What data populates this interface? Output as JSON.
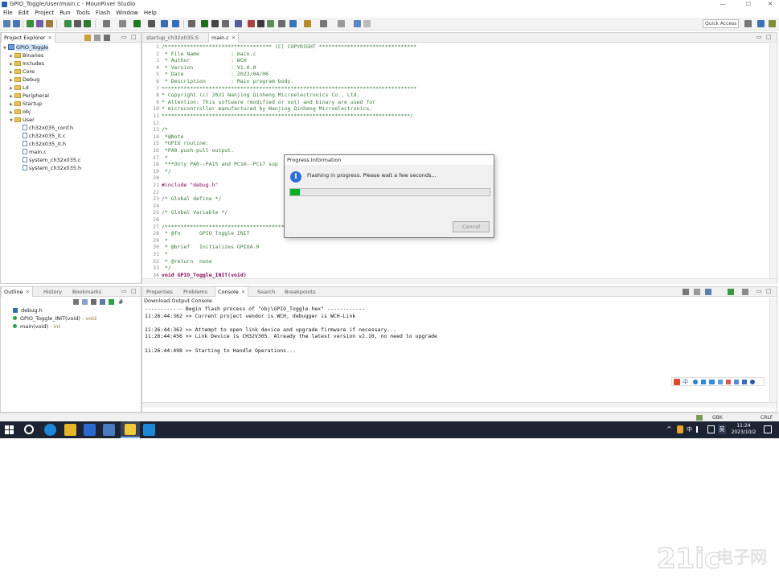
{
  "window": {
    "title": "GPIO_Toggle/User/main.c - MounRiver Studio",
    "controls": {
      "minimize": "—",
      "maximize": "☐",
      "close": "✕"
    }
  },
  "menu": [
    "File",
    "Edit",
    "Project",
    "Run",
    "Tools",
    "Flash",
    "Window",
    "Help"
  ],
  "toolbar": {
    "quick_access": "Quick Access"
  },
  "project_explorer": {
    "tab": "Project Explorer",
    "project": "GPIO_Toggle",
    "folders": [
      "Binaries",
      "Includes",
      "Core",
      "Debug",
      "Ld",
      "Peripheral",
      "Startup",
      "obj",
      "User"
    ],
    "user_files": [
      "ch32x035_conf.h",
      "ch32x035_it.c",
      "ch32x035_it.h",
      "main.c",
      "system_ch32x035.c",
      "system_ch32x035.h"
    ]
  },
  "editor": {
    "tabs": [
      "startup_ch32x035.S",
      "main.c"
    ],
    "lines": [
      {
        "n": "1",
        "t": "/********************************** (C) COPYRIGHT *******************************",
        "c": "cmt"
      },
      {
        "n": "2",
        "t": " * File Name          : main.c",
        "c": "cmt"
      },
      {
        "n": "3",
        "t": " * Author             : WCH",
        "c": "cmt"
      },
      {
        "n": "4",
        "t": " * Version            : V1.0.0",
        "c": "cmt"
      },
      {
        "n": "5",
        "t": " * Date               : 2023/04/06",
        "c": "cmt"
      },
      {
        "n": "6",
        "t": " * Description        : Main program body.",
        "c": "cmt"
      },
      {
        "n": "7",
        "t": "*********************************************************************************",
        "c": "cmt"
      },
      {
        "n": "8",
        "t": "* Copyright (c) 2021 Nanjing Qinheng Microelectronics Co., Ltd.",
        "c": "cmt"
      },
      {
        "n": "9",
        "t": "* Attention: This software (modified or not) and binary are used for",
        "c": "cmt"
      },
      {
        "n": "10",
        "t": "* microcontroller manufactured by Nanjing Qinheng Microelectronics.",
        "c": "cmt"
      },
      {
        "n": "11",
        "t": "*******************************************************************************/",
        "c": "cmt"
      },
      {
        "n": "12",
        "t": "",
        "c": ""
      },
      {
        "n": "13",
        "t": "/*",
        "c": "cmt"
      },
      {
        "n": "14",
        "t": " *@Note",
        "c": "cmt"
      },
      {
        "n": "15",
        "t": " *GPIO routine:",
        "c": "cmt"
      },
      {
        "n": "16",
        "t": " *PA0 push-pull output.",
        "c": "cmt"
      },
      {
        "n": "17",
        "t": " *",
        "c": "cmt"
      },
      {
        "n": "18",
        "t": " ***Only PA0--PA15 and PC16--PC17 sup",
        "c": "cmt"
      },
      {
        "n": "19",
        "t": " */",
        "c": "cmt"
      },
      {
        "n": "20",
        "t": "",
        "c": ""
      },
      {
        "n": "21",
        "t": "#include \"debug.h\"",
        "c": "dir"
      },
      {
        "n": "22",
        "t": "",
        "c": ""
      },
      {
        "n": "23",
        "t": "/* Global define */",
        "c": "cmt"
      },
      {
        "n": "24",
        "t": "",
        "c": ""
      },
      {
        "n": "25",
        "t": "/* Global Variable */",
        "c": "cmt"
      },
      {
        "n": "26",
        "t": "",
        "c": ""
      },
      {
        "n": "27",
        "t": "/*****************************************",
        "c": "cmt"
      },
      {
        "n": "28",
        "t": " * @fn      GPIO_Toggle_INIT",
        "c": "cmt"
      },
      {
        "n": "29",
        "t": " *",
        "c": "cmt"
      },
      {
        "n": "30",
        "t": " * @brief   Initializes GPIOA.0",
        "c": "cmt"
      },
      {
        "n": "31",
        "t": " *",
        "c": "cmt"
      },
      {
        "n": "32",
        "t": " * @return  none",
        "c": "cmt"
      },
      {
        "n": "33",
        "t": " */",
        "c": "cmt"
      },
      {
        "n": "34",
        "t": "void GPIO_Toggle_INIT(void)",
        "c": "kw"
      }
    ]
  },
  "dialog": {
    "title": "Progress Information",
    "message": "Flashing in progress. Please wait a few seconds...",
    "progress": 0.05,
    "cancel": "Cancel"
  },
  "outline": {
    "tabs": [
      "Outline",
      "History",
      "Bookmarks"
    ],
    "items": [
      {
        "name": "debug.h",
        "type": ""
      },
      {
        "name": "GPIO_Toggle_INIT(void)",
        "type": ": void"
      },
      {
        "name": "main(void)",
        "type": ": int"
      }
    ]
  },
  "console": {
    "tabs": [
      "Properties",
      "Problems",
      "Console",
      "Search",
      "Breakpoints"
    ],
    "title": "Download Output Console",
    "lines": [
      "------------ Begin flash process of \"obj\\GPIO_Toggle.hex\" ------------",
      "11:26:44:362 >> Current project vendor is WCH, debugger is WCH-Link",
      "",
      "11:26:44:362 >> Attempt to open link device and upgrade firmware if necessary...",
      "11:26:44:456 >> Link Device is CH32V305. Already the latest version v2.10, no need to upgrade",
      "",
      "11:26:44:498 >> Starting to Handle Operations..."
    ]
  },
  "statusbar": {
    "encoding": "GBK",
    "line_ending": "CRLF"
  },
  "taskbar": {
    "time": "11:24",
    "date": "2023/10/2",
    "ime": "中"
  },
  "watermark": {
    "text": "21ic电子网"
  }
}
